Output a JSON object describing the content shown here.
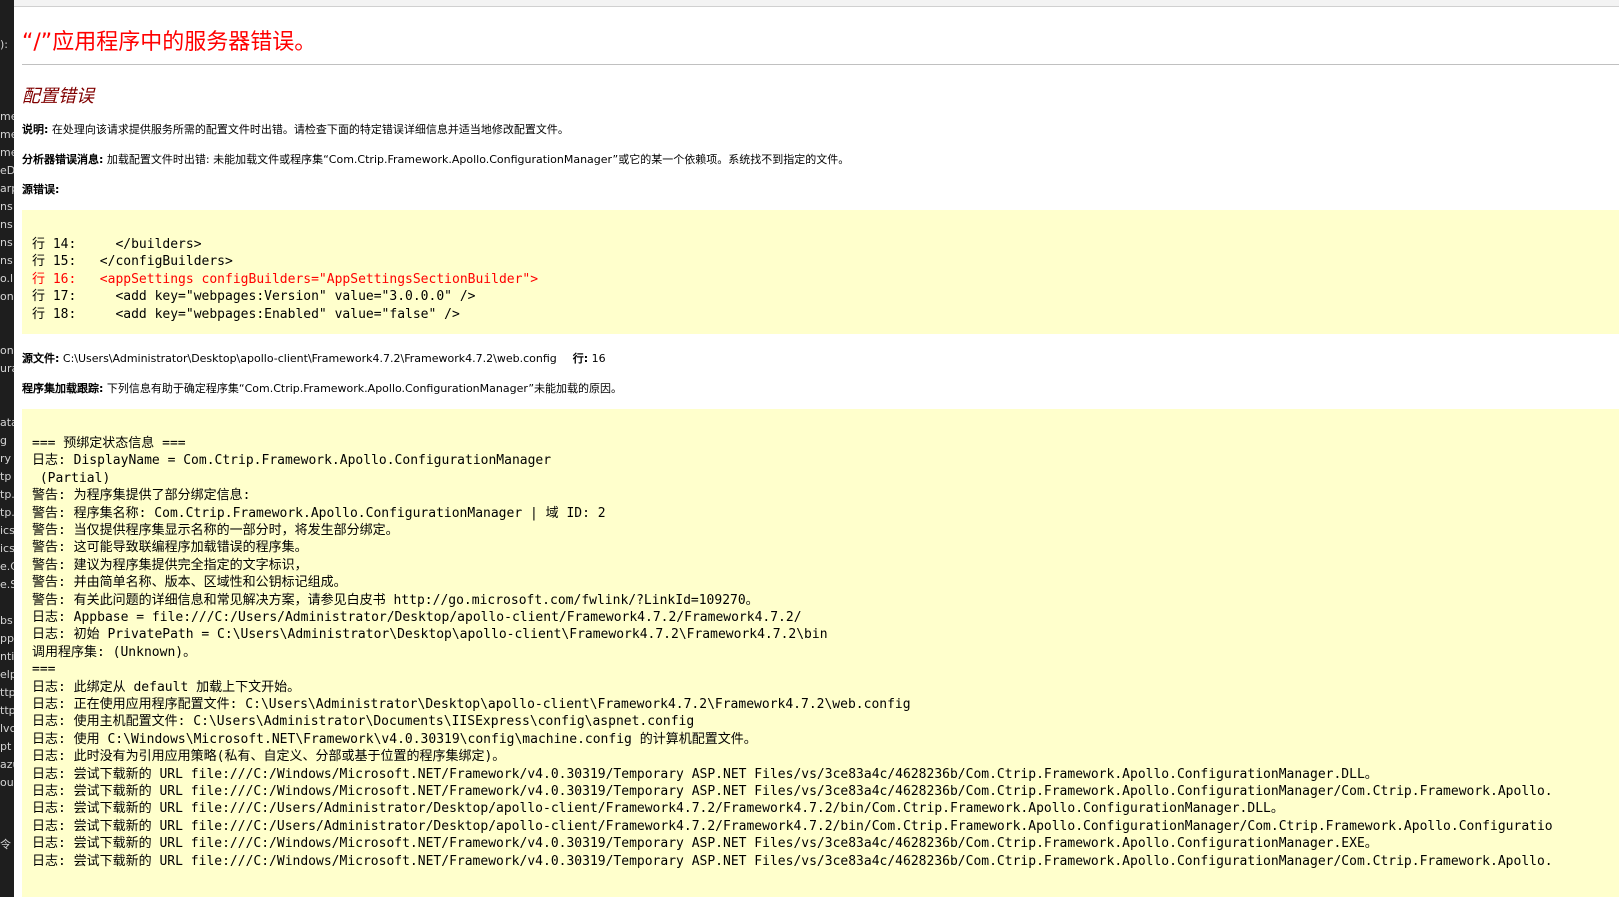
{
  "left_strip_fragments": [
    "):",
    "me",
    "me",
    "me",
    "eD",
    "arp",
    "ns",
    "ns",
    "ns",
    "ns",
    "o.lr",
    "on",
    "one",
    "ura",
    "ata",
    "g",
    "ry",
    "tp",
    "tp.",
    "tp.",
    "ics",
    "ics",
    "e.C",
    "e.S",
    "bs",
    "pp",
    "nti",
    "elp",
    "ttp",
    "ttp",
    "lvc",
    "pt",
    "azu",
    "ou",
    "令"
  ],
  "page": {
    "title": "“/”应用程序中的服务器错误。",
    "section_title": "配置错误",
    "description_label": "说明:",
    "description_text": " 在处理向该请求提供服务所需的配置文件时出错。请检查下面的特定错误详细信息并适当地修改配置文件。",
    "parser_label": "分析器错误消息:",
    "parser_text": " 加载配置文件时出错: 未能加载文件或程序集“Com.Ctrip.Framework.Apollo.ConfigurationManager”或它的某一个依赖项。系统找不到指定的文件。",
    "source_error_label": "源错误:",
    "source_file_label": "源文件:",
    "source_file_path": " C:\\Users\\Administrator\\Desktop\\apollo-client\\Framework4.7.2\\Framework4.7.2\\web.config",
    "line_label": "行:",
    "line_number": " 16",
    "assembly_trace_label": "程序集加载跟踪:",
    "assembly_trace_text": " 下列信息有助于确定程序集“Com.Ctrip.Framework.Apollo.ConfigurationManager”未能加载的原因。"
  },
  "source_lines": [
    {
      "text": "行 14:     </builders>",
      "error": false
    },
    {
      "text": "行 15:   </configBuilders>",
      "error": false
    },
    {
      "text": "行 16:   <appSettings configBuilders=\"AppSettingsSectionBuilder\">",
      "error": true
    },
    {
      "text": "行 17:     <add key=\"webpages:Version\" value=\"3.0.0.0\" />",
      "error": false
    },
    {
      "text": "行 18:     <add key=\"webpages:Enabled\" value=\"false\" />",
      "error": false
    }
  ],
  "trace_lines": [
    "=== 预绑定状态信息 ===",
    "日志: DisplayName = Com.Ctrip.Framework.Apollo.ConfigurationManager",
    " (Partial)",
    "警告: 为程序集提供了部分绑定信息:",
    "警告: 程序集名称: Com.Ctrip.Framework.Apollo.ConfigurationManager | 域 ID: 2",
    "警告: 当仅提供程序集显示名称的一部分时，将发生部分绑定。",
    "警告: 这可能导致联编程序加载错误的程序集。",
    "警告: 建议为程序集提供完全指定的文字标识，",
    "警告: 并由简单名称、版本、区域性和公钥标记组成。",
    "警告: 有关此问题的详细信息和常见解决方案，请参见白皮书 http://go.microsoft.com/fwlink/?LinkId=109270。",
    "日志: Appbase = file:///C:/Users/Administrator/Desktop/apollo-client/Framework4.7.2/Framework4.7.2/",
    "日志: 初始 PrivatePath = C:\\Users\\Administrator\\Desktop\\apollo-client\\Framework4.7.2\\Framework4.7.2\\bin",
    "调用程序集: (Unknown)。",
    "===",
    "日志: 此绑定从 default 加载上下文开始。",
    "日志: 正在使用应用程序配置文件: C:\\Users\\Administrator\\Desktop\\apollo-client\\Framework4.7.2\\Framework4.7.2\\web.config",
    "日志: 使用主机配置文件: C:\\Users\\Administrator\\Documents\\IISExpress\\config\\aspnet.config",
    "日志: 使用 C:\\Windows\\Microsoft.NET\\Framework\\v4.0.30319\\config\\machine.config 的计算机配置文件。",
    "日志: 此时没有为引用应用策略(私有、自定义、分部或基于位置的程序集绑定)。",
    "日志: 尝试下载新的 URL file:///C:/Windows/Microsoft.NET/Framework/v4.0.30319/Temporary ASP.NET Files/vs/3ce83a4c/4628236b/Com.Ctrip.Framework.Apollo.ConfigurationManager.DLL。",
    "日志: 尝试下载新的 URL file:///C:/Windows/Microsoft.NET/Framework/v4.0.30319/Temporary ASP.NET Files/vs/3ce83a4c/4628236b/Com.Ctrip.Framework.Apollo.ConfigurationManager/Com.Ctrip.Framework.Apollo.",
    "日志: 尝试下载新的 URL file:///C:/Users/Administrator/Desktop/apollo-client/Framework4.7.2/Framework4.7.2/bin/Com.Ctrip.Framework.Apollo.ConfigurationManager.DLL。",
    "日志: 尝试下载新的 URL file:///C:/Users/Administrator/Desktop/apollo-client/Framework4.7.2/Framework4.7.2/bin/Com.Ctrip.Framework.Apollo.ConfigurationManager/Com.Ctrip.Framework.Apollo.Configuratio",
    "日志: 尝试下载新的 URL file:///C:/Windows/Microsoft.NET/Framework/v4.0.30319/Temporary ASP.NET Files/vs/3ce83a4c/4628236b/Com.Ctrip.Framework.Apollo.ConfigurationManager.EXE。",
    "日志: 尝试下载新的 URL file:///C:/Windows/Microsoft.NET/Framework/v4.0.30319/Temporary ASP.NET Files/vs/3ce83a4c/4628236b/Com.Ctrip.Framework.Apollo.ConfigurationManager/Com.Ctrip.Framework.Apollo."
  ]
}
